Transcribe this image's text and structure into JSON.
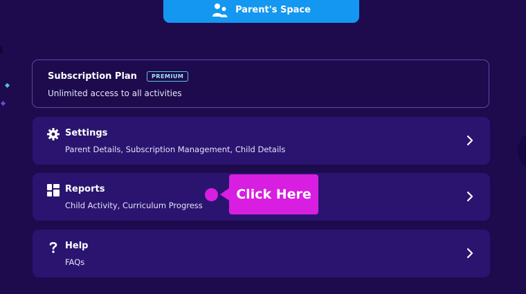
{
  "header": {
    "parent_space_label": "Parent's Space",
    "parent_space_icon": "parent-child-icon"
  },
  "subscription": {
    "title": "Subscription Plan",
    "badge": "PREMIUM",
    "description": "Unlimited access to all activities"
  },
  "menu": [
    {
      "title": "Settings",
      "description": "Parent Details, Subscription Management, Child Details",
      "icon": "gear-icon"
    },
    {
      "title": "Reports",
      "description": "Child Activity, Curriculum Progress",
      "icon": "dashboard-icon"
    },
    {
      "title": "Help",
      "description": "FAQs",
      "icon": "question-icon"
    }
  ],
  "callout": {
    "label": "Click Here"
  },
  "colors": {
    "background": "#1d0b4d",
    "card": "#2a1470",
    "accent_blue": "#1497f0",
    "callout_magenta": "#d81ee0",
    "badge_cyan": "#5fc9e8"
  }
}
